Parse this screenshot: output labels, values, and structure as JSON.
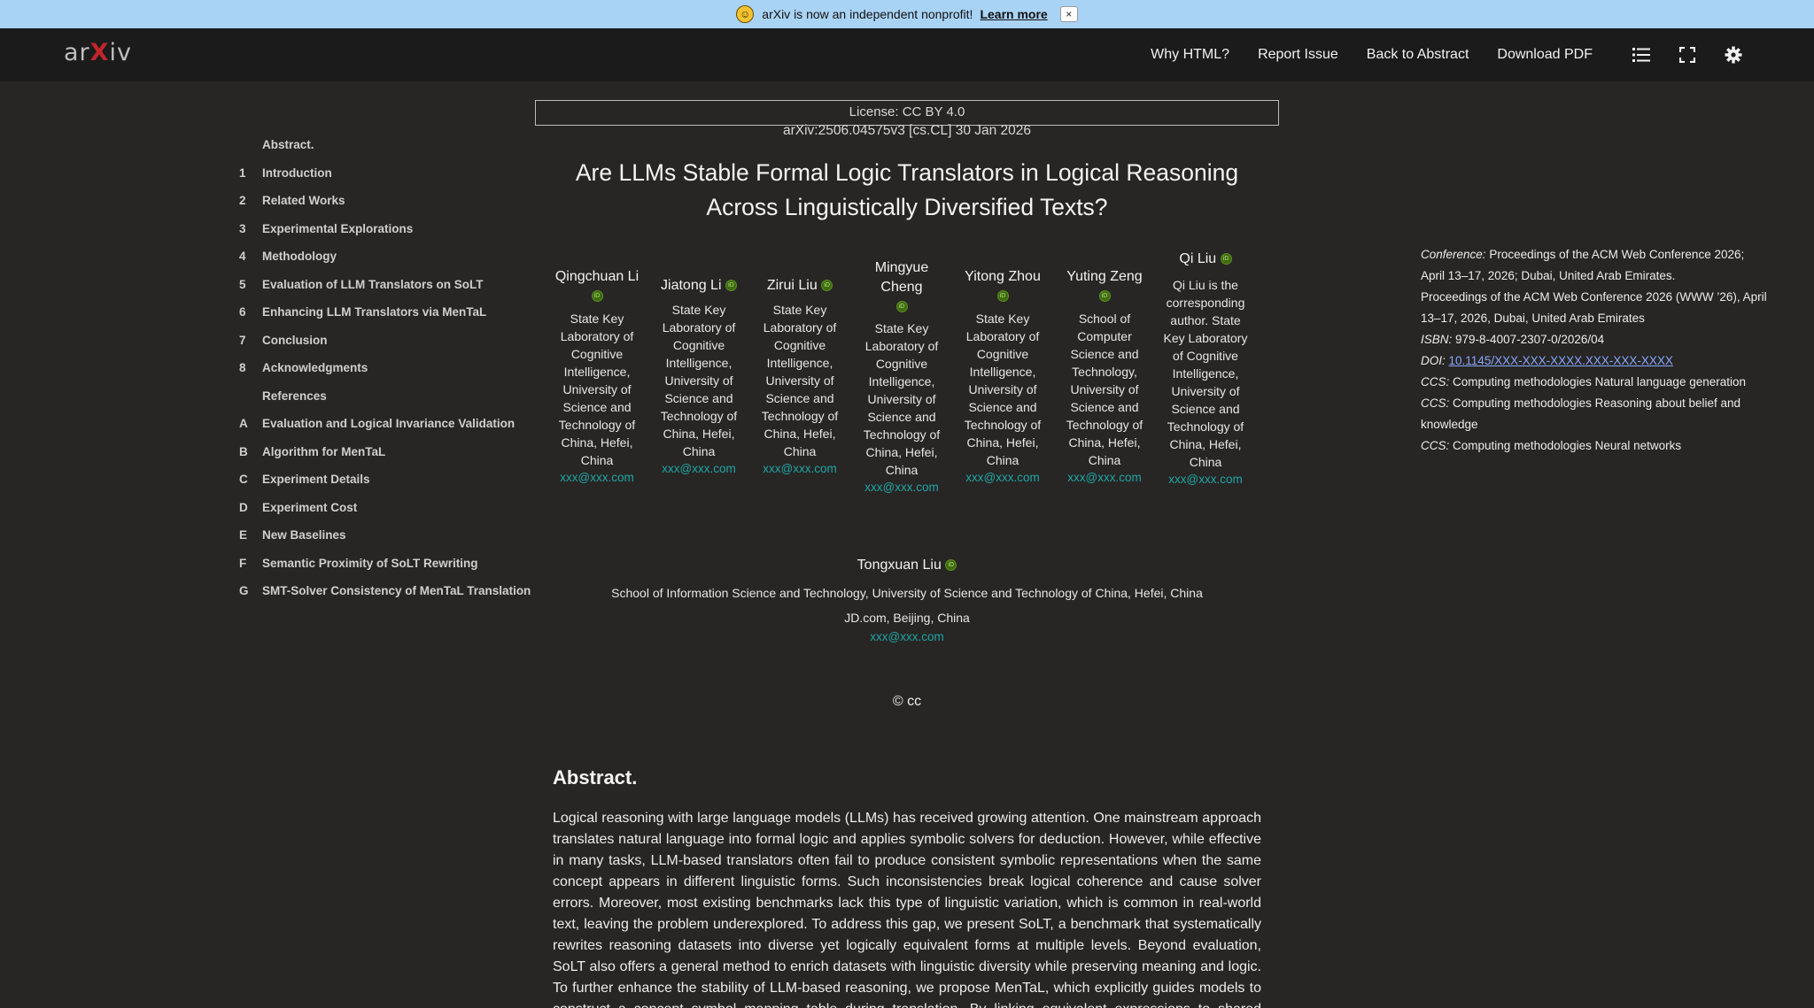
{
  "banner": {
    "icon": "smiley-face-icon",
    "text": "arXiv is now an independent nonprofit!",
    "link": "Learn more",
    "close": "×"
  },
  "header": {
    "logo_a": "ar",
    "logo_x": "X",
    "logo_b": "iv",
    "nav": [
      "Why HTML?",
      "Report Issue",
      "Back to Abstract",
      "Download PDF"
    ],
    "icons": [
      "list-icon",
      "fullscreen-icon",
      "settings-gear-icon"
    ]
  },
  "toc": [
    {
      "num": "",
      "label": "Abstract."
    },
    {
      "num": "1",
      "label": "Introduction"
    },
    {
      "num": "2",
      "label": "Related Works"
    },
    {
      "num": "3",
      "label": "Experimental Explorations"
    },
    {
      "num": "4",
      "label": "Methodology"
    },
    {
      "num": "5",
      "label": "Evaluation of LLM Translators on SoLT"
    },
    {
      "num": "6",
      "label": "Enhancing LLM Translators via MenTaL"
    },
    {
      "num": "7",
      "label": "Conclusion"
    },
    {
      "num": "8",
      "label": "Acknowledgments"
    },
    {
      "num": "",
      "label": "References"
    },
    {
      "num": "A",
      "label": "Evaluation and Logical Invariance Validation"
    },
    {
      "num": "B",
      "label": "Algorithm for MenTaL"
    },
    {
      "num": "C",
      "label": "Experiment Details"
    },
    {
      "num": "D",
      "label": "Experiment Cost"
    },
    {
      "num": "E",
      "label": "New Baselines"
    },
    {
      "num": "F",
      "label": "Semantic Proximity of SoLT Rewriting"
    },
    {
      "num": "G",
      "label": "SMT-Solver Consistency of MenTaL Translation"
    }
  ],
  "paper": {
    "license": "License: CC BY 4.0",
    "arxiv_id": "arXiv:2506.04575v3 [cs.CL] 30 Jan 2026",
    "title": "Are LLMs Stable Formal Logic Translators in Logical Reasoning Across Linguistically Diversified Texts?",
    "authors": [
      {
        "name": "Qingchuan Li",
        "aff": "State Key Laboratory of Cognitive Intelligence, University of Science and Technology of China, Hefei, China",
        "email": "xxx@xxx.com"
      },
      {
        "name": "Jiatong Li",
        "aff": "State Key Laboratory of Cognitive Intelligence, University of Science and Technology of China, Hefei, China",
        "email": "xxx@xxx.com"
      },
      {
        "name": "Zirui Liu",
        "aff": "State Key Laboratory of Cognitive Intelligence, University of Science and Technology of China, Hefei, China",
        "email": "xxx@xxx.com"
      },
      {
        "name": "Mingyue Cheng",
        "aff": "State Key Laboratory of Cognitive Intelligence, University of Science and Technology of China, Hefei, China",
        "email": "xxx@xxx.com"
      },
      {
        "name": "Yitong Zhou",
        "aff": "State Key Laboratory of Cognitive Intelligence, University of Science and Technology of China, Hefei, China",
        "email": "xxx@xxx.com"
      },
      {
        "name": "Yuting Zeng",
        "aff": "School of Computer Science and Technology, University of Science and Technology of China, Hefei, China",
        "email": "xxx@xxx.com"
      },
      {
        "name": "Qi Liu",
        "aff": "Qi Liu is the corresponding author. State Key Laboratory of Cognitive Intelligence, University of Science and Technology of China, Hefei, China",
        "email": "xxx@xxx.com"
      }
    ],
    "last_author": {
      "name": "Tongxuan Liu",
      "aff1": "School of Information Science and Technology, University of Science and Technology of China, Hefei, China",
      "aff2": "JD.com, Beijing, China",
      "email": "xxx@xxx.com"
    },
    "copyright": "© cc",
    "abstract_heading": "Abstract.",
    "abstract": "Logical reasoning with large language models (LLMs) has received growing attention. One mainstream approach translates natural language into formal logic and applies symbolic solvers for deduction. However, while effective in many tasks, LLM-based translators often fail to produce consistent symbolic representations when the same concept appears in different linguistic forms. Such inconsistencies break logical coherence and cause solver errors. Moreover, most existing benchmarks lack this type of linguistic variation, which is common in real-world text, leaving the problem underexplored. To address this gap, we present SoLT, a benchmark that systematically rewrites reasoning datasets into diverse yet logically equivalent forms at multiple levels. Beyond evaluation, SoLT also offers a general method to enrich datasets with linguistic diversity while preserving meaning and logic. To further enhance the stability of LLM-based reasoning, we propose MenTaL, which explicitly guides models to construct a concept–symbol mapping table during translation. By linking equivalent expressions to shared symbols, MenTaL maintains consistency and mitigates symbol drift."
  },
  "meta": [
    {
      "k": "Conference:",
      "v": "Proceedings of the ACM Web Conference 2026; April 13–17, 2026; Dubai, United Arab Emirates."
    },
    {
      "k": "",
      "v": "Proceedings of the ACM Web Conference 2026 (WWW ’26), April 13–17, 2026, Dubai, United Arab Emirates"
    },
    {
      "k": "ISBN:",
      "v": "979-8-4007-2307-0/2026/04"
    },
    {
      "k": "DOI:",
      "v": "10.1145/XXX-XXX-XXXX.XXX-XXX-XXXX",
      "link": true
    },
    {
      "k": "CCS:",
      "v": "Computing methodologies Natural language generation"
    },
    {
      "k": "CCS:",
      "v": "Computing methodologies Reasoning about belief and knowledge"
    },
    {
      "k": "CCS:",
      "v": "Computing methodologies Neural networks"
    }
  ]
}
